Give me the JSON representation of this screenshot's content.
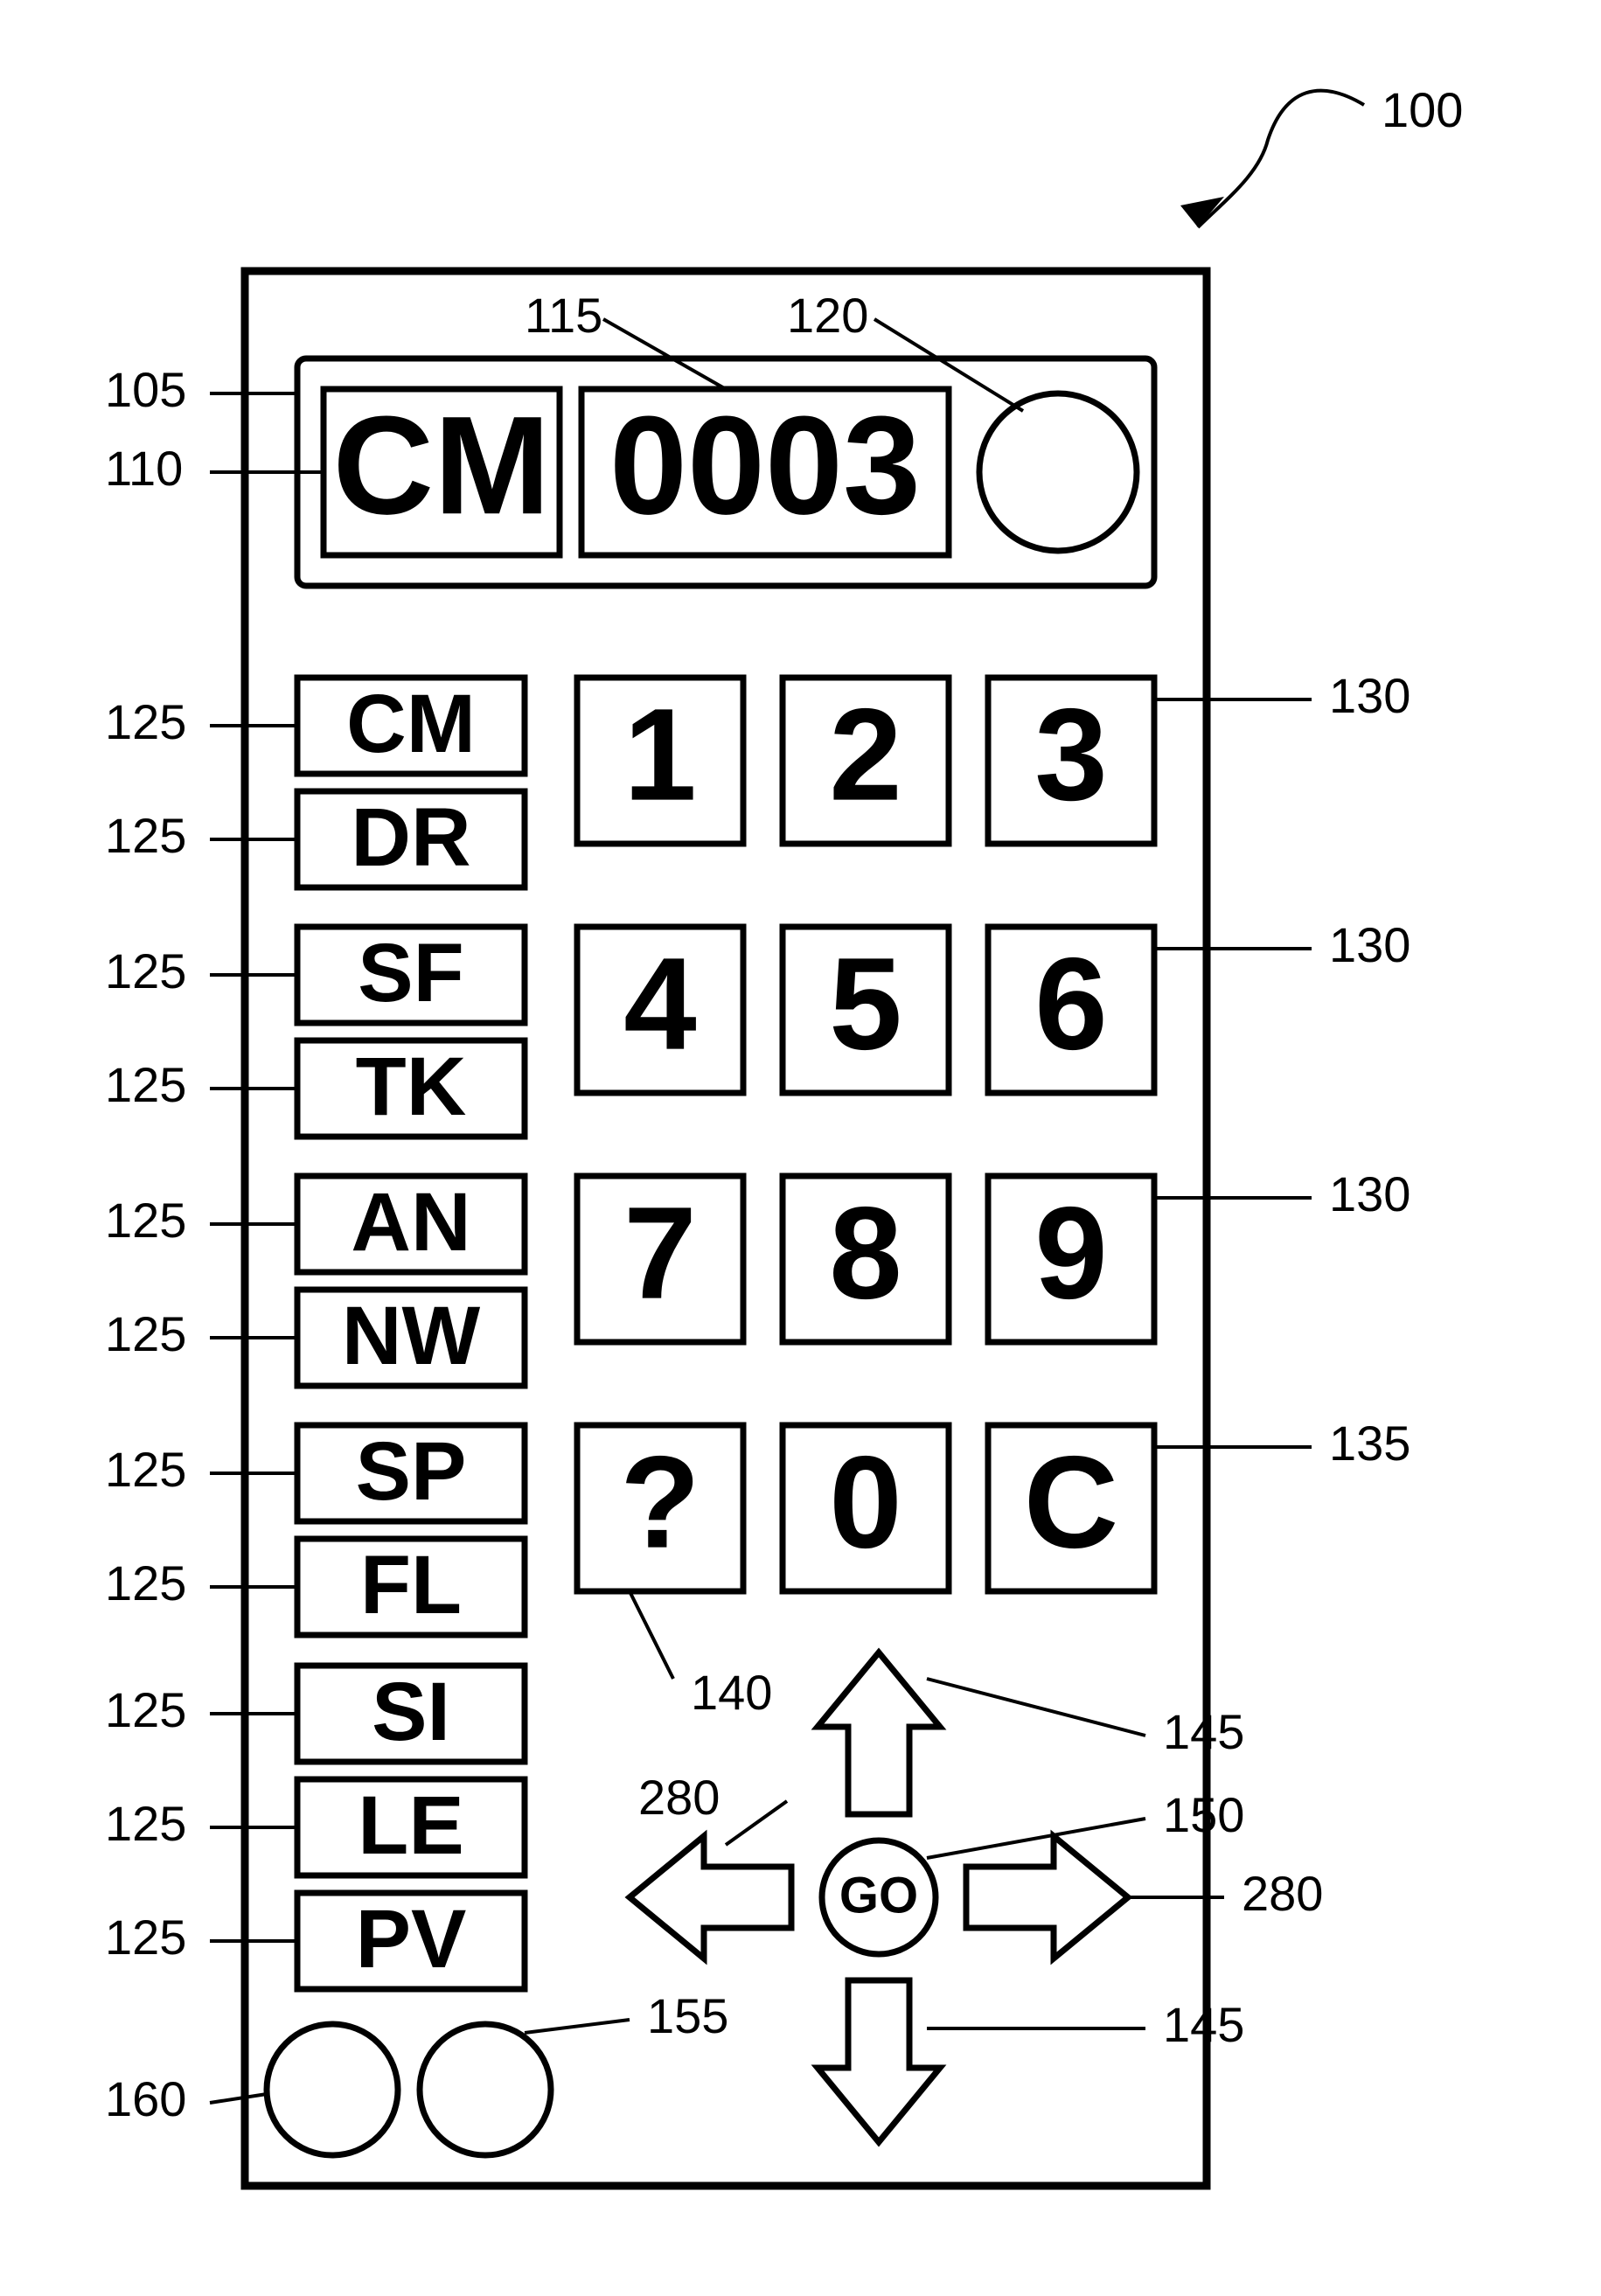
{
  "callouts": {
    "c100": "100",
    "c105": "105",
    "c110": "110",
    "c115": "115",
    "c120": "120",
    "c125": "125",
    "c130": "130",
    "c135": "135",
    "c140": "140",
    "c145": "145",
    "c150": "150",
    "c155": "155",
    "c160": "160",
    "c280": "280"
  },
  "display": {
    "mode": "CM",
    "value": "0003"
  },
  "modeButtons": [
    "CM",
    "DR",
    "SF",
    "TK",
    "AN",
    "NW",
    "SP",
    "FL",
    "SI",
    "LE",
    "PV"
  ],
  "keypad": {
    "k1": "1",
    "k2": "2",
    "k3": "3",
    "k4": "4",
    "k5": "5",
    "k6": "6",
    "k7": "7",
    "k8": "8",
    "k9": "9",
    "k0": "0",
    "help": "?",
    "clear": "C"
  },
  "go": "GO"
}
